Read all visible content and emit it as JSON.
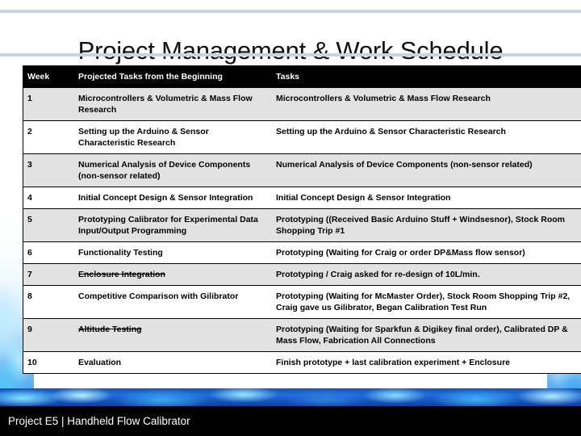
{
  "slide": {
    "title": "Project Management & Work Schedule",
    "footer_label": "Project E5 | Handheld Flow Calibrator",
    "colors": {
      "rule": "#c6d5e3",
      "header_row_bg": "#000000",
      "header_row_text": "#ffffff",
      "odd_row_bg": "#e2e2e2",
      "even_row_bg": "#ffffff",
      "footer_bg": "#000000",
      "footer_text": "#ffffff",
      "accent_water": "#1d6fd8"
    }
  },
  "table": {
    "columns": [
      "Week",
      "Projected Tasks from the Beginning",
      "Tasks"
    ],
    "rows": [
      {
        "week": "1",
        "projected": "Microcontrollers & Volumetric & Mass Flow Research",
        "projected_struck": false,
        "tasks": "Microcontrollers & Volumetric & Mass Flow Research"
      },
      {
        "week": "2",
        "projected": "Setting up the Arduino & Sensor Characteristic Research",
        "projected_struck": false,
        "tasks": "Setting up the Arduino & Sensor Characteristic Research"
      },
      {
        "week": "3",
        "projected": "Numerical Analysis of Device Components (non-sensor related)",
        "projected_struck": false,
        "tasks": "Numerical Analysis of Device Components (non-sensor related)"
      },
      {
        "week": "4",
        "projected": "Initial Concept Design & Sensor Integration",
        "projected_struck": false,
        "tasks": "Initial Concept Design & Sensor Integration"
      },
      {
        "week": "5",
        "projected": "Prototyping Calibrator for Experimental Data Input/Output Programming",
        "projected_struck": false,
        "tasks": "Prototyping ((Received Basic Arduino Stuff + Windsesnor), Stock Room Shopping Trip #1"
      },
      {
        "week": "6",
        "projected": "Functionality Testing",
        "projected_struck": false,
        "tasks": "Prototyping (Waiting for Craig or order DP&Mass flow sensor)"
      },
      {
        "week": "7",
        "projected": "Enclosure Integration",
        "projected_struck": true,
        "tasks": "Prototyping  / Craig asked for re-design of 10L/min."
      },
      {
        "week": "8",
        "projected": "Competitive Comparison with Gilibrator",
        "projected_struck": false,
        "tasks": "Prototyping (Waiting for McMaster Order),  Stock Room Shopping Trip #2, Craig gave us Gilibrator, Began Calibration Test Run"
      },
      {
        "week": "9",
        "projected": "Altitude Testing",
        "projected_struck": true,
        "tasks": "Prototyping (Waiting for Sparkfun & Digikey final order), Calibrated DP & Mass Flow, Fabrication All Connections"
      },
      {
        "week": "10",
        "projected": "Evaluation",
        "projected_struck": false,
        "tasks": "Finish prototype + last calibration experiment  + Enclosure"
      }
    ]
  }
}
